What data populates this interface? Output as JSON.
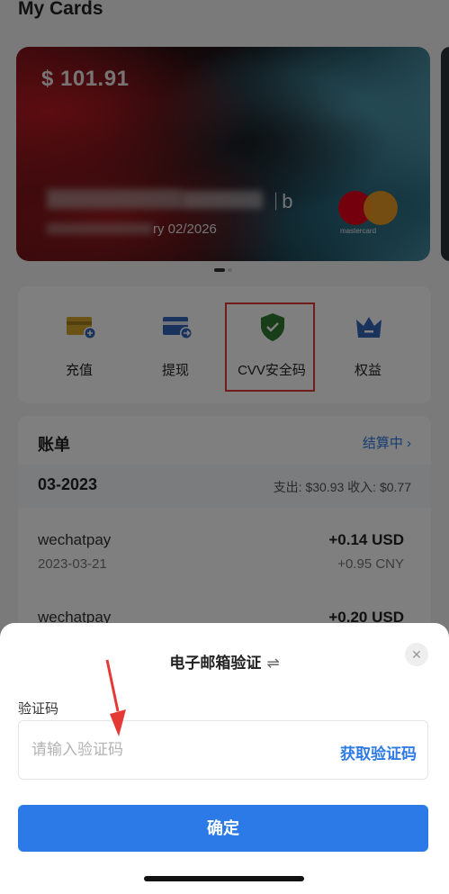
{
  "page": {
    "title": "My Cards"
  },
  "card": {
    "balance": "$ 101.91",
    "number_tail": "ᛁb",
    "expiry": "ry 02/2026",
    "brand": "mastercard"
  },
  "actions": [
    {
      "label": "充值",
      "icon": "top-up-card-icon"
    },
    {
      "label": "提现",
      "icon": "withdraw-card-icon"
    },
    {
      "label": "CVV安全码",
      "icon": "shield-check-icon"
    },
    {
      "label": "权益",
      "icon": "crown-icon"
    }
  ],
  "bill": {
    "title": "账单",
    "status": "结算中",
    "month": "03-2023",
    "summary": "支出: $30.93  收入: $0.77",
    "transactions": [
      {
        "name": "wechatpay",
        "date": "2023-03-21",
        "usd": "+0.14 USD",
        "cny": "+0.95 CNY"
      },
      {
        "name": "wechatpay",
        "date": "",
        "usd": "+0.20 USD",
        "cny": ""
      }
    ]
  },
  "sheet": {
    "title": "电子邮箱验证",
    "field_label": "验证码",
    "placeholder": "请输入验证码",
    "get_code": "获取验证码",
    "confirm": "确定"
  },
  "colors": {
    "accent": "#2b7ae8",
    "highlight": "#e53935",
    "action_icon": "#3266b8",
    "action_icon_gold": "#d4a62a",
    "shield": "#2e7d32"
  }
}
